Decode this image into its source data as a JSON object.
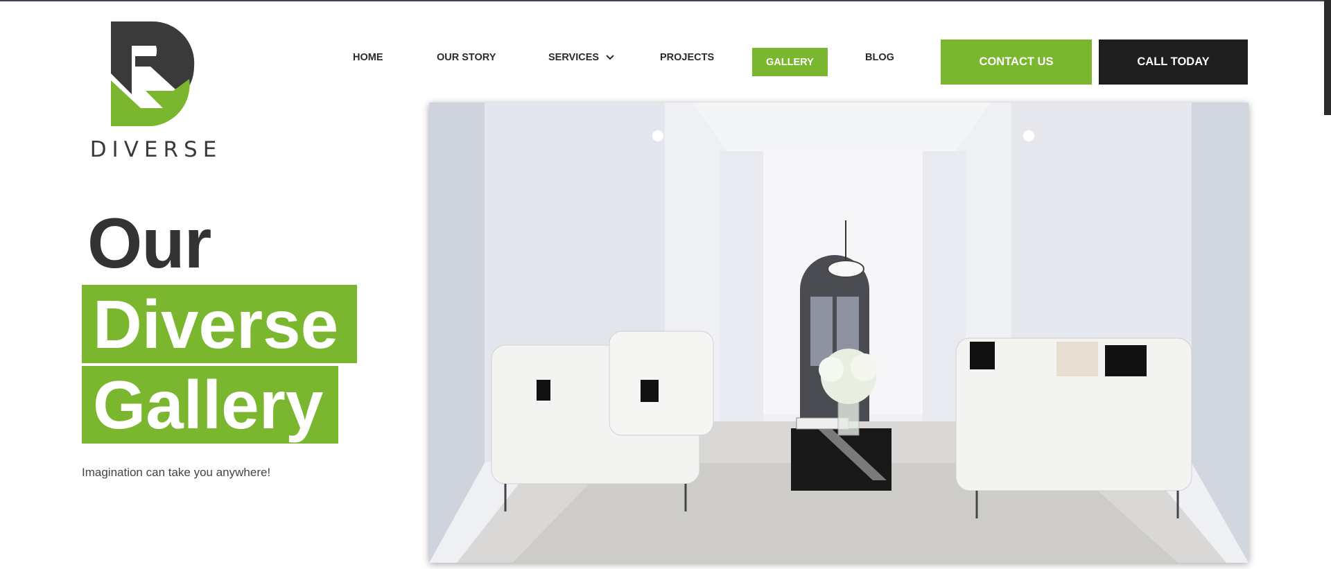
{
  "brand": {
    "name": "DIVERSE",
    "accent": "#7ab72f",
    "dark": "#333333"
  },
  "nav": {
    "items": [
      {
        "label": "HOME",
        "active": false
      },
      {
        "label": "OUR STORY",
        "active": false
      },
      {
        "label": "SERVICES",
        "active": false,
        "has_dropdown": true
      },
      {
        "label": "PROJECTS",
        "active": false
      },
      {
        "label": "GALLERY",
        "active": true
      },
      {
        "label": "BLOG",
        "active": false
      }
    ],
    "contact_label": "CONTACT US",
    "call_label": "CALL TODAY"
  },
  "hero": {
    "line1": "Our",
    "line2": "Diverse",
    "line3": "Gallery",
    "tagline": "Imagination can take you anywhere!"
  },
  "icons": {
    "dropdown": "chevron-down-icon",
    "logo": "diverse-logo-icon"
  }
}
